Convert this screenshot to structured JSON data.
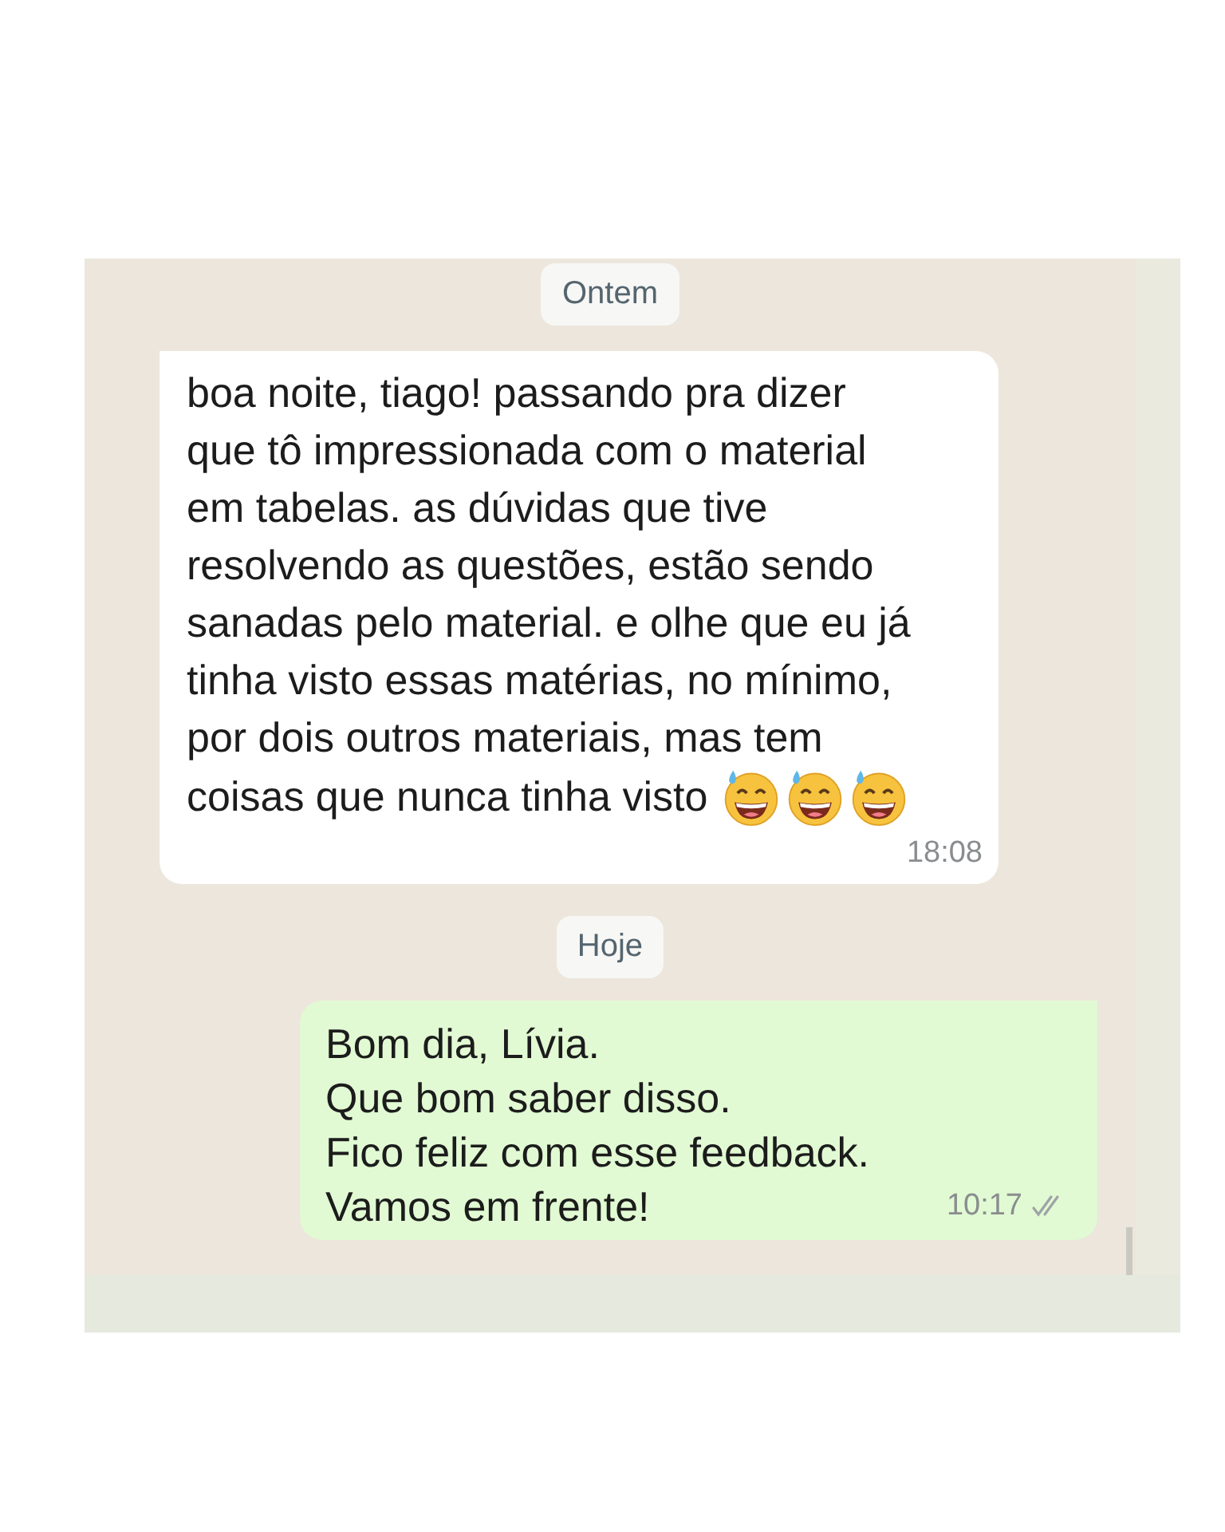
{
  "chat": {
    "items": [
      {
        "kind": "date",
        "text": "Ontem"
      },
      {
        "kind": "incoming",
        "lines": [
          "boa noite, tiago! passando pra dizer",
          "que tô impressionada com o material",
          "em tabelas. as dúvidas que tive",
          "resolvendo as questões, estão sendo",
          "sanadas pelo material. e olhe que eu já",
          "tinha visto essas matérias, no mínimo,",
          "por dois outros materiais, mas tem",
          "coisas que nunca tinha visto"
        ],
        "emojis": [
          {
            "kind": "sweat-smile"
          },
          {
            "kind": "sweat-smile"
          },
          {
            "kind": "sweat-smile"
          }
        ],
        "time": "18:08"
      },
      {
        "kind": "date",
        "text": "Hoje"
      },
      {
        "kind": "outgoing",
        "lines": [
          "Bom dia, Lívia.",
          "Que bom saber disso.",
          "Fico feliz com esse feedback.",
          "Vamos em frente!"
        ],
        "time": "10:17",
        "read": false
      }
    ]
  }
}
